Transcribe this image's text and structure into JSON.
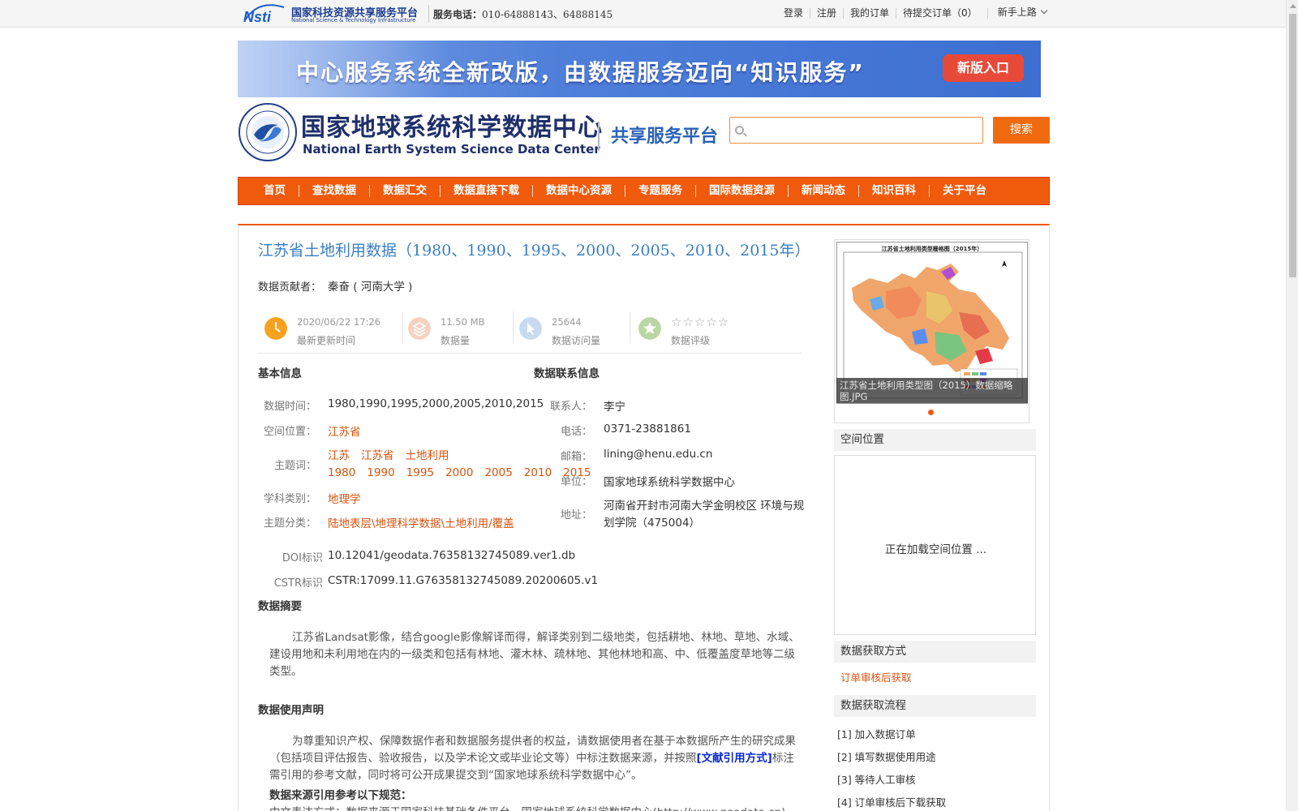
{
  "topbar": {
    "logo_line1": "国家科技资源共享服务平台",
    "logo_line2": "National Science & Technology Infrastructure",
    "phone_label": "服务电话：",
    "phone_value": "010-64888143、64888145",
    "links": [
      "登录",
      "注册",
      "我的订单",
      "待提交订单（0）"
    ],
    "guide": "新手上路"
  },
  "banner": {
    "text": "中心服务系统全新改版，由数据服务迈向“知识服务”",
    "button": "新版入口"
  },
  "site": {
    "name_cn": "国家地球系统科学数据中心",
    "name_en": "National Earth System Science Data Center",
    "subtitle": "共享服务平台"
  },
  "search": {
    "placeholder": "",
    "button": "搜索"
  },
  "nav": [
    "首页",
    "查找数据",
    "数据汇交",
    "数据直接下载",
    "数据中心资源",
    "专题服务",
    "国际数据资源",
    "新闻动态",
    "知识百科",
    "关于平台"
  ],
  "dataset": {
    "title": "江苏省土地利用数据（1980、1990、1995、2000、2005、2010、2015年）",
    "contributor_label": "数据贡献者：",
    "contributor": "秦奋 ( 河南大学 )",
    "stats": {
      "updated_value": "2020/06/22 17:26",
      "updated_label": "最新更新时间",
      "size_value": "11.50 MB",
      "size_label": "数据量",
      "visits_value": "25644",
      "visits_label": "数据访问量",
      "rating_stars": "☆☆☆☆☆",
      "rating_label": "数据评级"
    },
    "basic": {
      "heading": "基本信息",
      "time_label": "数据时间：",
      "time_value": "1980,1990,1995,2000,2005,2010,2015",
      "location_label": "空间位置：",
      "location_value": "江苏省",
      "keywords_label": "主题词：",
      "keywords": [
        "江苏",
        "江苏省",
        "土地利用",
        "1980",
        "1990",
        "1995",
        "2000",
        "2005",
        "2010",
        "2015"
      ],
      "discipline_label": "学科类别：",
      "discipline_value": "地理学",
      "category_label": "主题分类：",
      "category_value": "陆地表层\\地理科学数据\\土地利用/覆盖",
      "doi_label": "DOI标识",
      "doi_value": "10.12041/geodata.76358132745089.ver1.db",
      "cstr_label": "CSTR标识",
      "cstr_value": "CSTR:17099.11.G76358132745089.20200605.v1"
    },
    "contact": {
      "heading": "数据联系信息",
      "person_label": "联系人：",
      "person_value": "李宁",
      "phone_label": "电话：",
      "phone_value": "0371-23881861",
      "email_label": "邮箱：",
      "email_value": "lining@henu.edu.cn",
      "unit_label": "单位：",
      "unit_value": "国家地球系统科学数据中心",
      "address_label": "地址：",
      "address_value": "河南省开封市河南大学金明校区 环境与规划学院（475004）"
    },
    "abstract": {
      "heading": "数据摘要",
      "text": "江苏省Landsat影像，结合google影像解译而得，解译类别到二级地类，包括耕地、林地、草地、水域、建设用地和未利用地在内的一级类和包括有林地、灌木林、疏林地、其他林地和高、中、低覆盖度草地等二级类型。"
    },
    "usage": {
      "heading": "数据使用声明",
      "text_before": "为尊重知识产权、保障数据作者和数据服务提供者的权益，请数据使用者在基于本数据所产生的研究成果（包括项目评估报告、验收报告，以及学术论文或毕业论文等）中标注数据来源，并按照",
      "link": "[文献引用方式]",
      "text_after": "标注需引用的参考文献，同时将可公开成果提交到“国家地球系统科学数据中心”。",
      "cite_heading": "数据来源引用参考以下规范：",
      "cite_text": "中文表达方式：数据来源于国家科技基础条件平台—国家地球系统科学数据中心(http://www.geodata.cn)。"
    }
  },
  "sidebar": {
    "thumb_title": "江苏省土地利用类型栅格图（2015年）",
    "thumb_caption": "江苏省土地利用类型图（2015）数据缩略图.JPG",
    "spatial_heading": "空间位置",
    "map_loading": "正在加载空间位置 ...",
    "access_heading": "数据获取方式",
    "access_value": "订单审核后获取",
    "flow_heading": "数据获取流程",
    "flow_steps": [
      "[1] 加入数据订单",
      "[2] 填写数据使用用途",
      "[3] 等待人工审核",
      "[4] 订单审核后下载获取"
    ]
  },
  "colors": {
    "accent_orange": "#f05a0c",
    "title_blue": "#3a7fc4",
    "link_blue": "#0a2acf"
  }
}
